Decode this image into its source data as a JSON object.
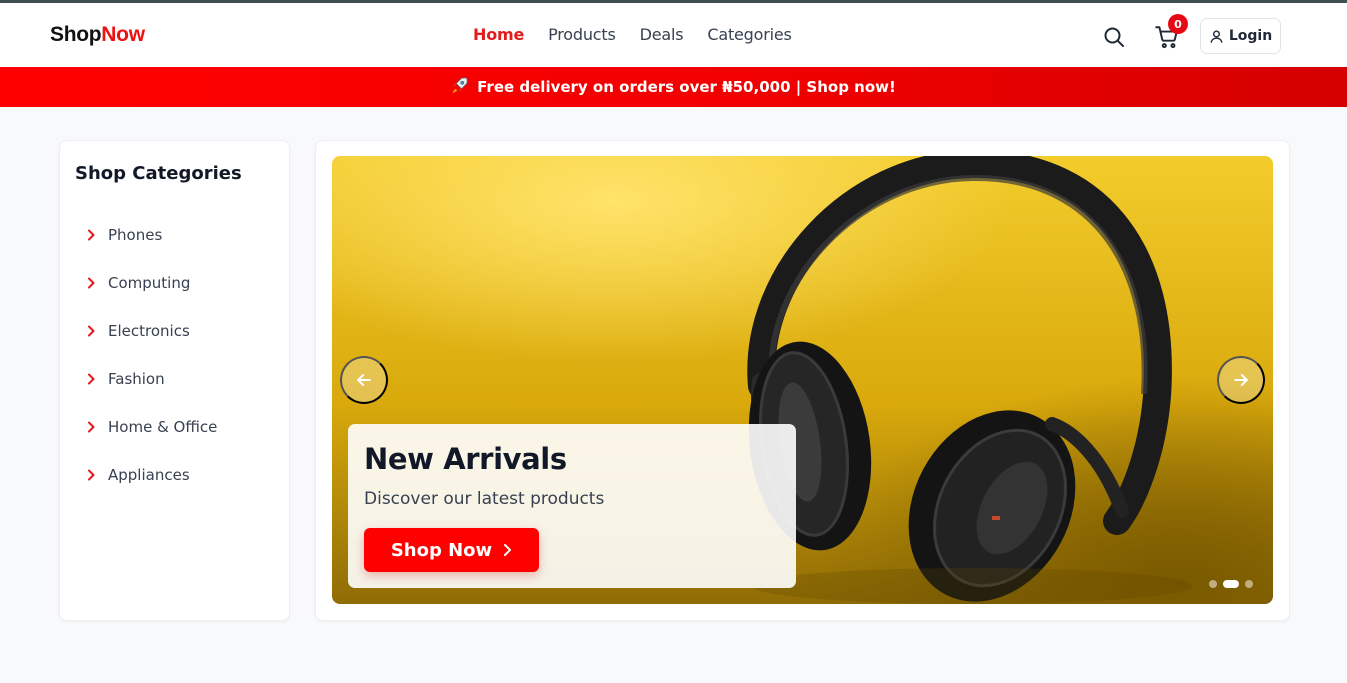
{
  "header": {
    "logo_part1": "Shop",
    "logo_part2": "Now",
    "nav": [
      {
        "label": "Home",
        "active": true
      },
      {
        "label": "Products",
        "active": false
      },
      {
        "label": "Deals",
        "active": false
      },
      {
        "label": "Categories",
        "active": false
      }
    ],
    "cart_count": "0",
    "login_label": "Login",
    "icons": {
      "search": "search-icon",
      "cart": "cart-icon",
      "user": "user-icon"
    }
  },
  "promo": {
    "icon": "rocket-icon",
    "text": "Free delivery on orders over ₦50,000 | Shop now!"
  },
  "sidebar": {
    "title": "Shop Categories",
    "items": [
      {
        "label": "Phones"
      },
      {
        "label": "Computing"
      },
      {
        "label": "Electronics"
      },
      {
        "label": "Fashion"
      },
      {
        "label": "Home & Office"
      },
      {
        "label": "Appliances"
      }
    ]
  },
  "hero": {
    "title": "New Arrivals",
    "subtitle": "Discover our latest products",
    "button_label": "Shop Now",
    "slide_count": 3,
    "active_slide": 2
  },
  "colors": {
    "accent": "#ff0000",
    "text_dark": "#111827",
    "page_bg": "#f8f9fb"
  }
}
